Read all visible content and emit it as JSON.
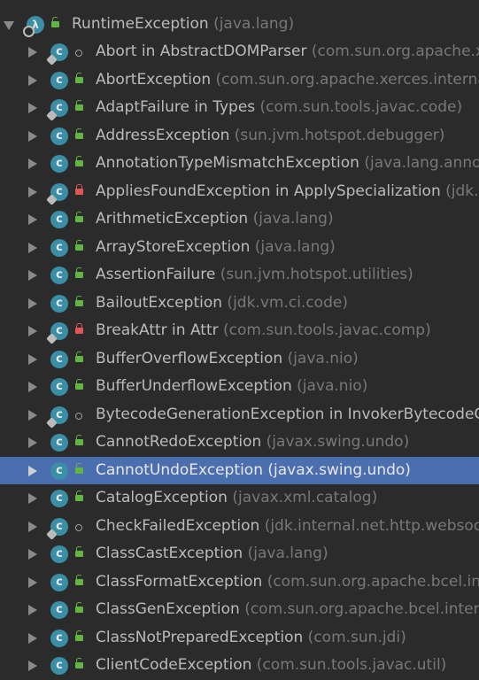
{
  "tree": {
    "root": {
      "name": "RuntimeException",
      "package": "(java.lang)",
      "icon": "lambda-class-icon",
      "visibility": "public"
    },
    "children": [
      {
        "name": "Abort in AbstractDOMParser",
        "package": "(com.sun.org.apache.xerces.internal.parsers)",
        "icon": "static-class-icon",
        "visibility": "package"
      },
      {
        "name": "AbortException",
        "package": "(com.sun.org.apache.xerces.internal.impl.io)",
        "icon": "class-icon",
        "visibility": "public"
      },
      {
        "name": "AdaptFailure in Types",
        "package": "(com.sun.tools.javac.code)",
        "icon": "static-class-icon",
        "visibility": "public"
      },
      {
        "name": "AddressException",
        "package": "(sun.jvm.hotspot.debugger)",
        "icon": "class-icon",
        "visibility": "public"
      },
      {
        "name": "AnnotationTypeMismatchException",
        "package": "(java.lang.annotation)",
        "icon": "class-icon",
        "visibility": "public"
      },
      {
        "name": "AppliesFoundException in ApplySpecialization",
        "package": "(jdk.nashorn)",
        "icon": "static-class-icon",
        "visibility": "private"
      },
      {
        "name": "ArithmeticException",
        "package": "(java.lang)",
        "icon": "class-icon",
        "visibility": "public"
      },
      {
        "name": "ArrayStoreException",
        "package": "(java.lang)",
        "icon": "class-icon",
        "visibility": "public"
      },
      {
        "name": "AssertionFailure",
        "package": "(sun.jvm.hotspot.utilities)",
        "icon": "class-icon",
        "visibility": "public"
      },
      {
        "name": "BailoutException",
        "package": "(jdk.vm.ci.code)",
        "icon": "class-icon",
        "visibility": "public"
      },
      {
        "name": "BreakAttr in Attr",
        "package": "(com.sun.tools.javac.comp)",
        "icon": "static-class-icon",
        "visibility": "private"
      },
      {
        "name": "BufferOverflowException",
        "package": "(java.nio)",
        "icon": "class-icon",
        "visibility": "public"
      },
      {
        "name": "BufferUnderflowException",
        "package": "(java.nio)",
        "icon": "class-icon",
        "visibility": "public"
      },
      {
        "name": "BytecodeGenerationException in InvokerBytecodeGenerator",
        "package": "",
        "icon": "static-class-icon",
        "visibility": "package"
      },
      {
        "name": "CannotRedoException",
        "package": "(javax.swing.undo)",
        "icon": "class-icon",
        "visibility": "public"
      },
      {
        "name": "CannotUndoException",
        "package": "(javax.swing.undo)",
        "icon": "class-icon",
        "visibility": "public",
        "selected": true
      },
      {
        "name": "CatalogException",
        "package": "(javax.xml.catalog)",
        "icon": "class-icon",
        "visibility": "public"
      },
      {
        "name": "CheckFailedException",
        "package": "(jdk.internal.net.http.websocket)",
        "icon": "static-class-icon",
        "visibility": "package"
      },
      {
        "name": "ClassCastException",
        "package": "(java.lang)",
        "icon": "class-icon",
        "visibility": "public"
      },
      {
        "name": "ClassFormatException",
        "package": "(com.sun.org.apache.bcel.internal.classfile)",
        "icon": "class-icon",
        "visibility": "public"
      },
      {
        "name": "ClassGenException",
        "package": "(com.sun.org.apache.bcel.internal.generic)",
        "icon": "class-icon",
        "visibility": "public"
      },
      {
        "name": "ClassNotPreparedException",
        "package": "(com.sun.jdi)",
        "icon": "class-icon",
        "visibility": "public"
      },
      {
        "name": "ClientCodeException",
        "package": "(com.sun.tools.javac.util)",
        "icon": "class-icon",
        "visibility": "public"
      }
    ]
  }
}
